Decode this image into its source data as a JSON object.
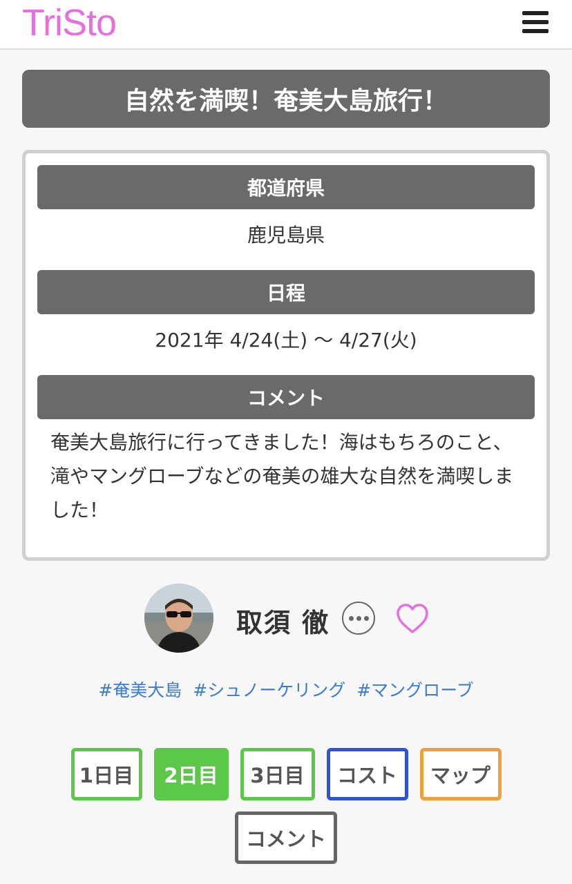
{
  "header": {
    "logo": "TriSto"
  },
  "trip": {
    "title": "自然を満喫！奄美大島旅行！",
    "prefecture_label": "都道府県",
    "prefecture": "鹿児島県",
    "schedule_label": "日程",
    "schedule": "2021年 4/24(土) 〜 4/27(火)",
    "comment_label": "コメント",
    "comment": "奄美大島旅行に行ってきました！海はもちろのこと、滝やマングローブなどの奄美の雄大な自然を満喫しました！"
  },
  "author": {
    "name": "取須 徹"
  },
  "tags": [
    "#奄美大島",
    "#シュノーケリング",
    "#マングローブ"
  ],
  "tabs": [
    {
      "label": "1日目",
      "color": "#5bc84a",
      "active": false
    },
    {
      "label": "2日目",
      "color": "#5bc84a",
      "active": true
    },
    {
      "label": "3日目",
      "color": "#5bc84a",
      "active": false
    },
    {
      "label": "コスト",
      "color": "#2f55d4",
      "active": false
    },
    {
      "label": "マップ",
      "color": "#eea040",
      "active": false
    },
    {
      "label": "コメント",
      "color": "#666666",
      "active": false
    }
  ],
  "colors": {
    "logo": "#e66fe0",
    "heart": "#e66fe0",
    "tag": "#3a7bd5",
    "section": "#6a6a6a"
  }
}
